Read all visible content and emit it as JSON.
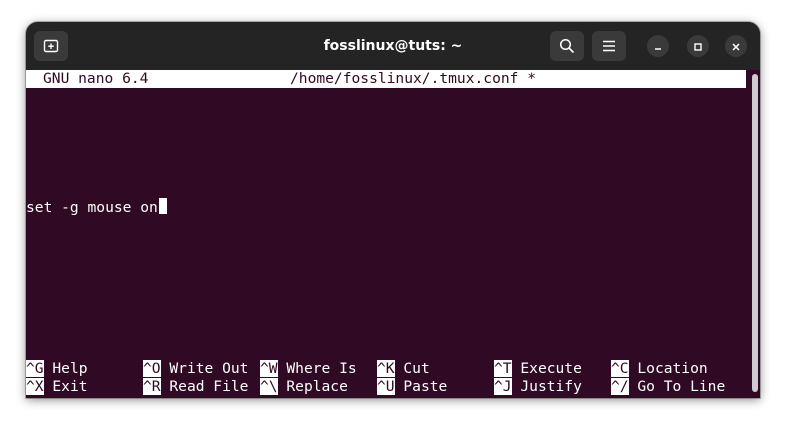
{
  "window": {
    "title": "fosslinux@tuts: ~"
  },
  "icons": {
    "new_tab": "new-tab-icon",
    "search": "search-icon",
    "menu": "hamburger-menu-icon",
    "minimize": "minimize-icon",
    "maximize": "maximize-icon",
    "close": "close-icon"
  },
  "nano": {
    "version": "GNU nano 6.4",
    "filename": "/home/fosslinux/.tmux.conf *",
    "content_line": "set -g mouse on"
  },
  "shortcuts": {
    "row1": [
      {
        "key": "^G",
        "label": "Help"
      },
      {
        "key": "^O",
        "label": "Write Out"
      },
      {
        "key": "^W",
        "label": "Where Is"
      },
      {
        "key": "^K",
        "label": "Cut"
      },
      {
        "key": "^T",
        "label": "Execute"
      },
      {
        "key": "^C",
        "label": "Location"
      }
    ],
    "row2": [
      {
        "key": "^X",
        "label": "Exit"
      },
      {
        "key": "^R",
        "label": "Read File"
      },
      {
        "key": "^\\",
        "label": "Replace"
      },
      {
        "key": "^U",
        "label": "Paste"
      },
      {
        "key": "^J",
        "label": "Justify"
      },
      {
        "key": "^/",
        "label": "Go To Line"
      }
    ]
  },
  "colors": {
    "terminal_bg": "#300a24",
    "titlebar_bg": "#242424",
    "text": "#ffffff"
  }
}
